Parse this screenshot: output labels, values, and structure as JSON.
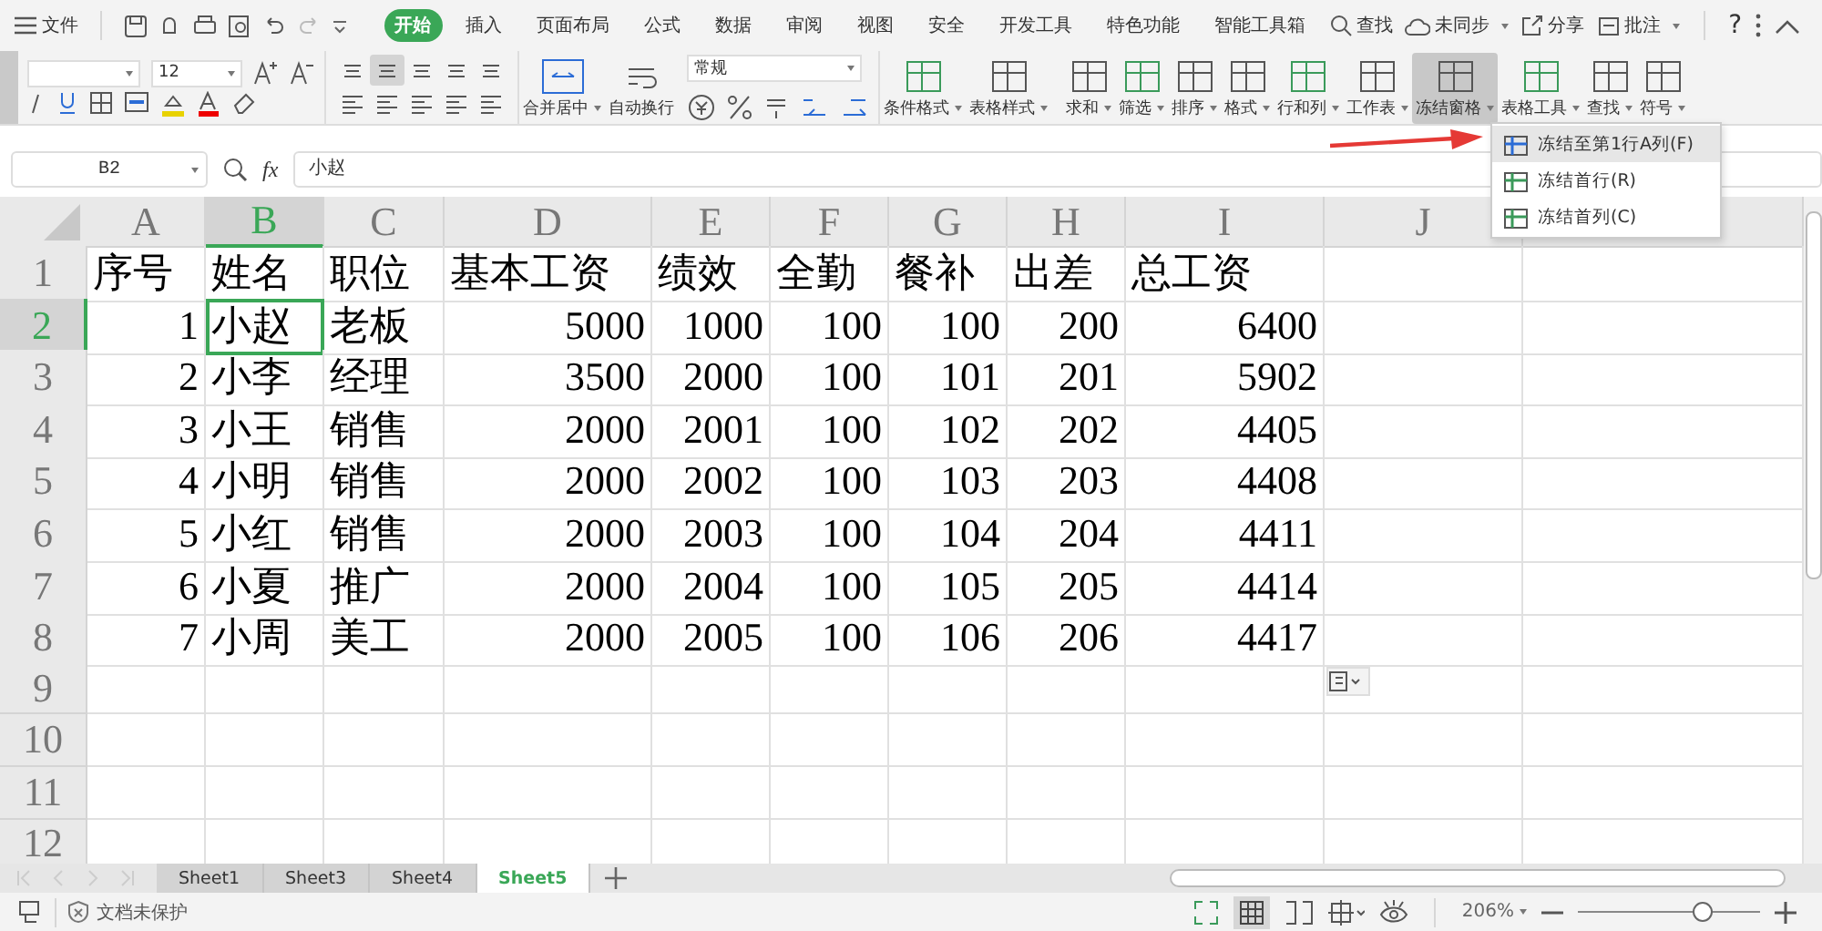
{
  "title_bar": {
    "file_menu": "文件",
    "tabs": [
      {
        "label": "开始",
        "selected": true
      },
      {
        "label": "插入",
        "selected": false
      },
      {
        "label": "页面布局",
        "selected": false
      },
      {
        "label": "公式",
        "selected": false
      },
      {
        "label": "数据",
        "selected": false
      },
      {
        "label": "审阅",
        "selected": false
      },
      {
        "label": "视图",
        "selected": false
      },
      {
        "label": "安全",
        "selected": false
      },
      {
        "label": "开发工具",
        "selected": false
      },
      {
        "label": "特色功能",
        "selected": false
      },
      {
        "label": "智能工具箱",
        "selected": false
      }
    ],
    "search": "查找",
    "sync": "未同步",
    "share": "分享",
    "comment": "批注",
    "help": "?"
  },
  "ribbon": {
    "font_size": "12",
    "number_format": "常规",
    "merge": "合并居中",
    "wrap": "自动换行",
    "big_buttons": [
      {
        "label": "条件格式",
        "pressed": false
      },
      {
        "label": "表格样式",
        "pressed": false
      },
      {
        "label": "求和",
        "pressed": false
      },
      {
        "label": "筛选",
        "pressed": false
      },
      {
        "label": "排序",
        "pressed": false
      },
      {
        "label": "格式",
        "pressed": false
      },
      {
        "label": "行和列",
        "pressed": false
      },
      {
        "label": "工作表",
        "pressed": false
      },
      {
        "label": "冻结窗格",
        "pressed": true
      },
      {
        "label": "表格工具",
        "pressed": false
      },
      {
        "label": "查找",
        "pressed": false
      },
      {
        "label": "符号",
        "pressed": false
      }
    ]
  },
  "freeze_menu": [
    {
      "label": "冻结至第1行A列(F)",
      "selected": true
    },
    {
      "label": "冻结首行(R)",
      "selected": false
    },
    {
      "label": "冻结首列(C)",
      "selected": false
    }
  ],
  "formula_bar": {
    "name_box": "B2",
    "fx": "fx",
    "value": "小赵"
  },
  "grid": {
    "columns": [
      {
        "label": "A",
        "selected": false
      },
      {
        "label": "B",
        "selected": true
      },
      {
        "label": "C",
        "selected": false
      },
      {
        "label": "D",
        "selected": false
      },
      {
        "label": "E",
        "selected": false
      },
      {
        "label": "F",
        "selected": false
      },
      {
        "label": "G",
        "selected": false
      },
      {
        "label": "H",
        "selected": false
      },
      {
        "label": "I",
        "selected": false
      },
      {
        "label": "J",
        "selected": false
      }
    ],
    "rows": [
      {
        "number": "1",
        "selected": false,
        "cells": [
          {
            "text": "序号",
            "kind": "text"
          },
          {
            "text": "姓名",
            "kind": "text"
          },
          {
            "text": "职位",
            "kind": "text"
          },
          {
            "text": "基本工资",
            "kind": "text"
          },
          {
            "text": "绩效",
            "kind": "text"
          },
          {
            "text": "全勤",
            "kind": "text"
          },
          {
            "text": "餐补",
            "kind": "text"
          },
          {
            "text": "出差",
            "kind": "text"
          },
          {
            "text": "总工资",
            "kind": "text"
          }
        ]
      },
      {
        "number": "2",
        "selected": true,
        "cells": [
          {
            "text": "1",
            "kind": "number"
          },
          {
            "text": "小赵",
            "kind": "text"
          },
          {
            "text": "老板",
            "kind": "text"
          },
          {
            "text": "5000",
            "kind": "number"
          },
          {
            "text": "1000",
            "kind": "number"
          },
          {
            "text": "100",
            "kind": "number"
          },
          {
            "text": "100",
            "kind": "number"
          },
          {
            "text": "200",
            "kind": "number"
          },
          {
            "text": "6400",
            "kind": "number"
          }
        ]
      },
      {
        "number": "3",
        "selected": false,
        "cells": [
          {
            "text": "2",
            "kind": "number"
          },
          {
            "text": "小李",
            "kind": "text"
          },
          {
            "text": "经理",
            "kind": "text"
          },
          {
            "text": "3500",
            "kind": "number"
          },
          {
            "text": "2000",
            "kind": "number"
          },
          {
            "text": "100",
            "kind": "number"
          },
          {
            "text": "101",
            "kind": "number"
          },
          {
            "text": "201",
            "kind": "number"
          },
          {
            "text": "5902",
            "kind": "number"
          }
        ]
      },
      {
        "number": "4",
        "selected": false,
        "cells": [
          {
            "text": "3",
            "kind": "number"
          },
          {
            "text": "小王",
            "kind": "text"
          },
          {
            "text": "销售",
            "kind": "text"
          },
          {
            "text": "2000",
            "kind": "number"
          },
          {
            "text": "2001",
            "kind": "number"
          },
          {
            "text": "100",
            "kind": "number"
          },
          {
            "text": "102",
            "kind": "number"
          },
          {
            "text": "202",
            "kind": "number"
          },
          {
            "text": "4405",
            "kind": "number"
          }
        ]
      },
      {
        "number": "5",
        "selected": false,
        "cells": [
          {
            "text": "4",
            "kind": "number"
          },
          {
            "text": "小明",
            "kind": "text"
          },
          {
            "text": "销售",
            "kind": "text"
          },
          {
            "text": "2000",
            "kind": "number"
          },
          {
            "text": "2002",
            "kind": "number"
          },
          {
            "text": "100",
            "kind": "number"
          },
          {
            "text": "103",
            "kind": "number"
          },
          {
            "text": "203",
            "kind": "number"
          },
          {
            "text": "4408",
            "kind": "number"
          }
        ]
      },
      {
        "number": "6",
        "selected": false,
        "cells": [
          {
            "text": "5",
            "kind": "number"
          },
          {
            "text": "小红",
            "kind": "text"
          },
          {
            "text": "销售",
            "kind": "text"
          },
          {
            "text": "2000",
            "kind": "number"
          },
          {
            "text": "2003",
            "kind": "number"
          },
          {
            "text": "100",
            "kind": "number"
          },
          {
            "text": "104",
            "kind": "number"
          },
          {
            "text": "204",
            "kind": "number"
          },
          {
            "text": "4411",
            "kind": "number"
          }
        ]
      },
      {
        "number": "7",
        "selected": false,
        "cells": [
          {
            "text": "6",
            "kind": "number"
          },
          {
            "text": "小夏",
            "kind": "text"
          },
          {
            "text": "推广",
            "kind": "text"
          },
          {
            "text": "2000",
            "kind": "number"
          },
          {
            "text": "2004",
            "kind": "number"
          },
          {
            "text": "100",
            "kind": "number"
          },
          {
            "text": "105",
            "kind": "number"
          },
          {
            "text": "205",
            "kind": "number"
          },
          {
            "text": "4414",
            "kind": "number"
          }
        ]
      },
      {
        "number": "8",
        "selected": false,
        "cells": [
          {
            "text": "7",
            "kind": "number"
          },
          {
            "text": "小周",
            "kind": "text"
          },
          {
            "text": "美工",
            "kind": "text"
          },
          {
            "text": "2000",
            "kind": "number"
          },
          {
            "text": "2005",
            "kind": "number"
          },
          {
            "text": "100",
            "kind": "number"
          },
          {
            "text": "106",
            "kind": "number"
          },
          {
            "text": "206",
            "kind": "number"
          },
          {
            "text": "4417",
            "kind": "number"
          }
        ]
      },
      {
        "number": "9",
        "selected": false
      },
      {
        "number": "10",
        "selected": false
      },
      {
        "number": "11",
        "selected": false
      },
      {
        "number": "12",
        "selected": false
      }
    ]
  },
  "sheets": [
    {
      "label": "Sheet1",
      "selected": false
    },
    {
      "label": "Sheet3",
      "selected": false
    },
    {
      "label": "Sheet4",
      "selected": false
    },
    {
      "label": "Sheet5",
      "selected": true
    }
  ],
  "status_bar": {
    "protection": "文档未保护",
    "zoom": "206%",
    "zoom_slider": {
      "level": 0.68
    }
  }
}
